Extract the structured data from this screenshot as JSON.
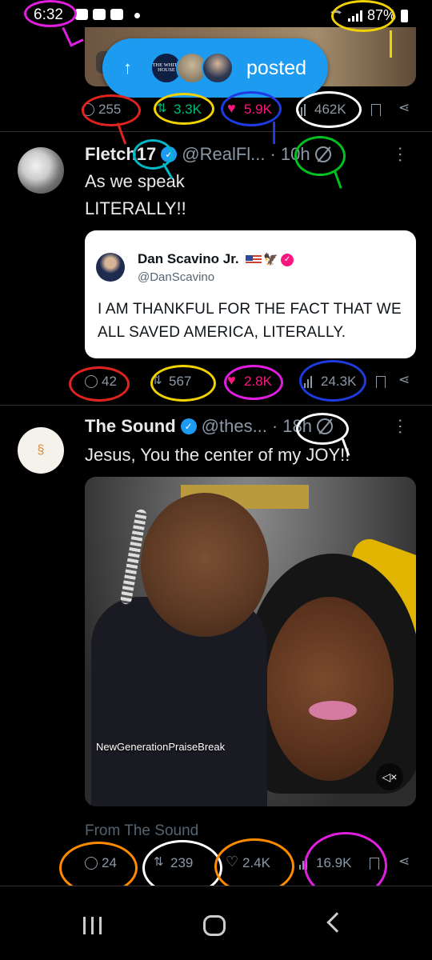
{
  "status_bar": {
    "time": "6:32",
    "battery": "87%"
  },
  "posted_pill": {
    "label": "posted",
    "logo_text": "THE WHITE HOUSE"
  },
  "tweet0": {
    "actions": {
      "replies": "255",
      "reposts": "3.3K",
      "likes": "5.9K",
      "views": "462K"
    }
  },
  "tweet1": {
    "name": "Fletch17",
    "handle": "@RealFl...",
    "time": "10h",
    "text_lines": [
      "As we speak",
      "LITERALLY!!"
    ],
    "quote": {
      "name": "Dan Scavino Jr.",
      "handle": "@DanScavino",
      "text": "I AM THANKFUL FOR THE FACT THAT WE ALL SAVED AMERICA, LITERALLY."
    },
    "actions": {
      "replies": "42",
      "reposts": "567",
      "likes": "2.8K",
      "views": "24.3K"
    }
  },
  "tweet2": {
    "name": "The Sound",
    "handle": "@thes...",
    "time": "18h",
    "text": "Jesus, You the center of my JOY!!",
    "video_watermark": "NewGenerationPraiseBreak",
    "from_label": "From The Sound",
    "actions": {
      "replies": "24",
      "reposts": "239",
      "likes": "2.4K",
      "views": "16.9K"
    }
  },
  "colors": {
    "accent": "#1d9bf0",
    "like": "#f91880",
    "repost": "#00ba7c",
    "background": "#000000"
  },
  "annotations": {
    "colors": [
      "magenta",
      "yellow",
      "red",
      "green",
      "blue",
      "white",
      "orange"
    ]
  }
}
